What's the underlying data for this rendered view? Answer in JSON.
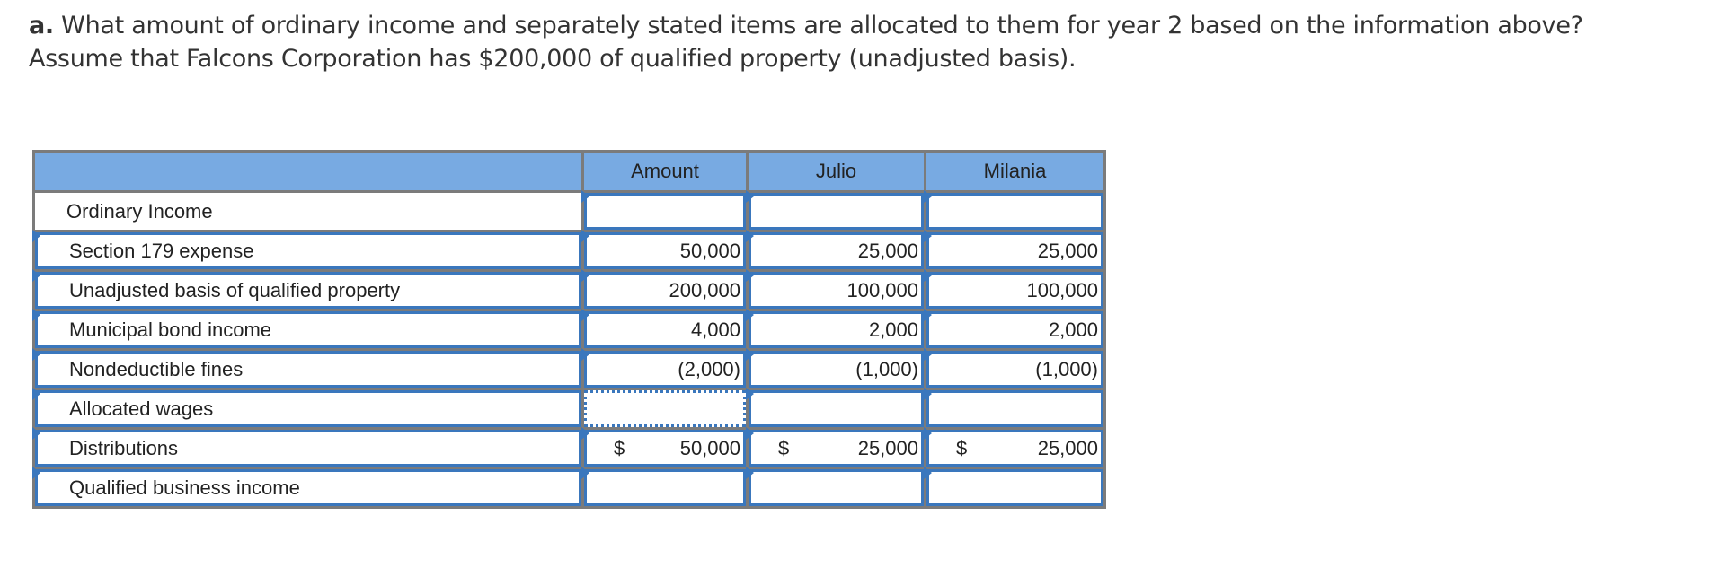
{
  "question": {
    "prefix": "a.",
    "line1": " What amount of ordinary income and separately stated items are allocated to them for year 2 based on the information above?",
    "line2": "Assume that Falcons Corporation has $200,000 of qualified property (unadjusted basis)."
  },
  "table": {
    "headers": [
      "",
      "Amount",
      "Julio",
      "Milania"
    ],
    "rows": [
      {
        "label": "Ordinary Income",
        "amount": "",
        "julio": "",
        "milania": "",
        "dollar": false,
        "label_input": false
      },
      {
        "label": "Section 179 expense",
        "amount": "50,000",
        "julio": "25,000",
        "milania": "25,000",
        "dollar": false,
        "label_input": true
      },
      {
        "label": "Unadjusted basis of qualified property",
        "amount": "200,000",
        "julio": "100,000",
        "milania": "100,000",
        "dollar": false,
        "label_input": true
      },
      {
        "label": "Municipal bond income",
        "amount": "4,000",
        "julio": "2,000",
        "milania": "2,000",
        "dollar": false,
        "label_input": true
      },
      {
        "label": "Nondeductible fines",
        "amount": "(2,000)",
        "julio": "(1,000)",
        "milania": "(1,000)",
        "dollar": false,
        "label_input": true
      },
      {
        "label": "Allocated wages",
        "amount": "",
        "julio": "",
        "milania": "",
        "dollar": false,
        "label_input": true,
        "focused": "amount"
      },
      {
        "label": "Distributions",
        "amount": "50,000",
        "julio": "25,000",
        "milania": "25,000",
        "dollar": true,
        "label_input": true
      },
      {
        "label": "Qualified business income",
        "amount": "",
        "julio": "",
        "milania": "",
        "dollar": false,
        "label_input": true
      }
    ],
    "currency_symbol": "$"
  },
  "colors": {
    "header_bg": "#78aae2",
    "input_border": "#3a77bd",
    "grid_line": "#7b7b7b"
  }
}
